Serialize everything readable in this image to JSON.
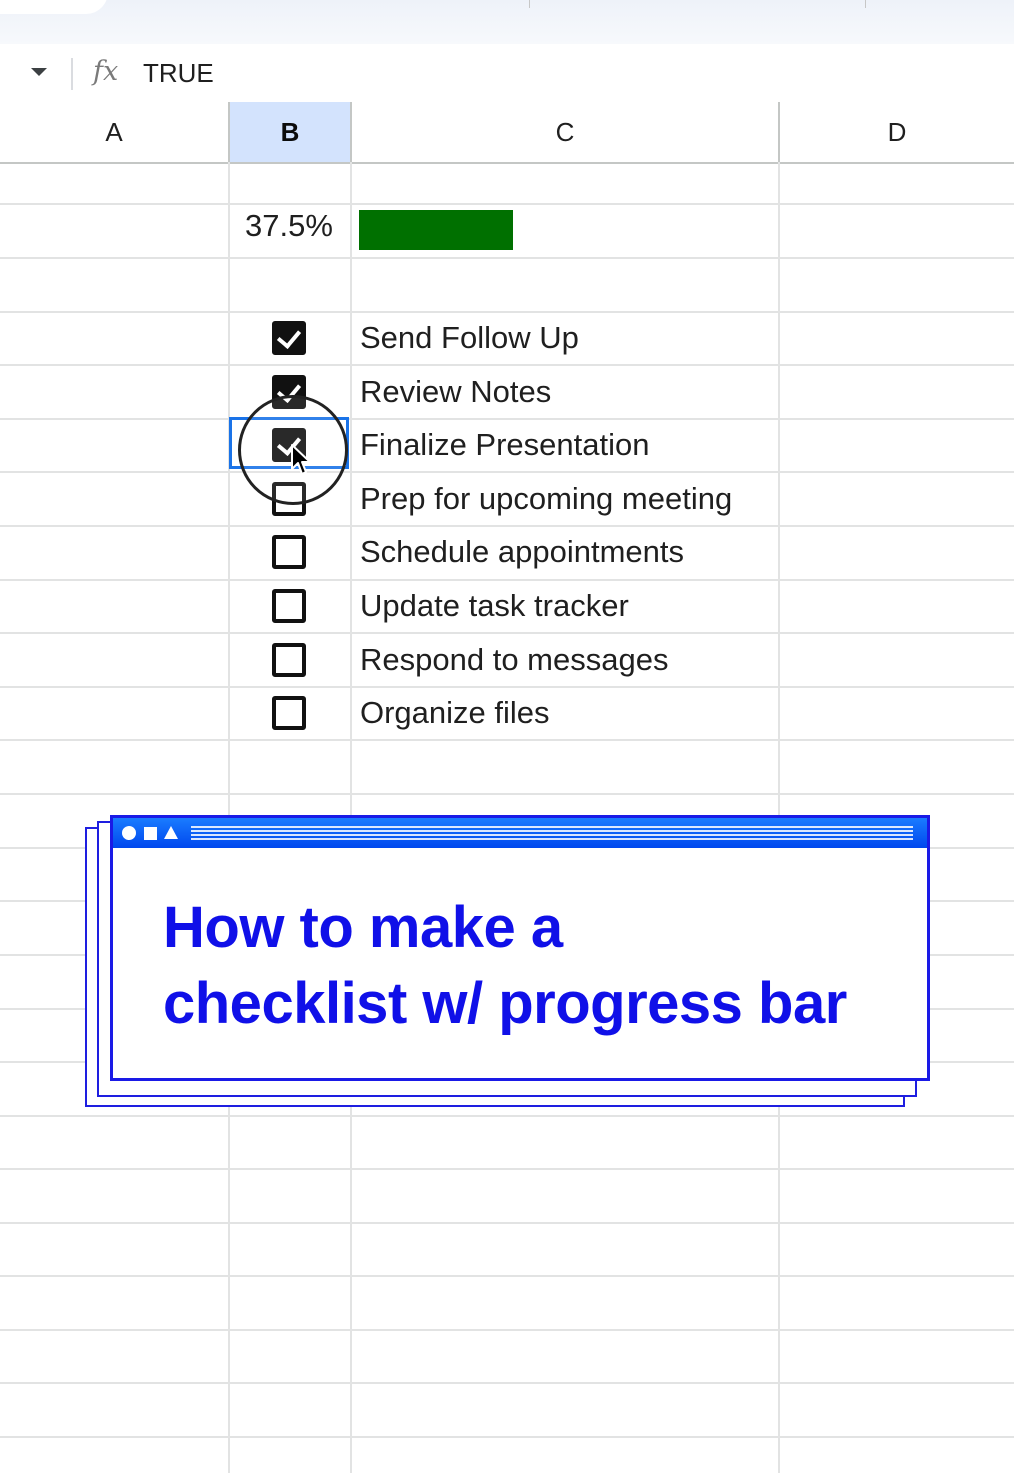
{
  "formula_bar": {
    "value": "TRUE"
  },
  "columns": [
    {
      "label": "A",
      "selected": false
    },
    {
      "label": "B",
      "selected": true
    },
    {
      "label": "C",
      "selected": false
    },
    {
      "label": "D",
      "selected": false
    }
  ],
  "progress": {
    "percent_label": "37.5%",
    "fraction": 0.375,
    "color": "#007000"
  },
  "tasks": [
    {
      "label": "Send Follow Up",
      "checked": true
    },
    {
      "label": "Review Notes",
      "checked": true
    },
    {
      "label": "Finalize Presentation",
      "checked": true
    },
    {
      "label": "Prep for upcoming meeting",
      "checked": false
    },
    {
      "label": "Schedule appointments",
      "checked": false
    },
    {
      "label": "Update task tracker",
      "checked": false
    },
    {
      "label": "Respond to messages",
      "checked": false
    },
    {
      "label": "Organize files",
      "checked": false
    }
  ],
  "title_card": {
    "line1": "How to make a",
    "line2": "checklist w/ progress bar",
    "accent_color": "#1010e8"
  },
  "icons": [
    "dropdown-caret-icon",
    "fx-icon",
    "cursor-pointer-icon",
    "circle-icon",
    "square-icon",
    "triangle-icon"
  ]
}
